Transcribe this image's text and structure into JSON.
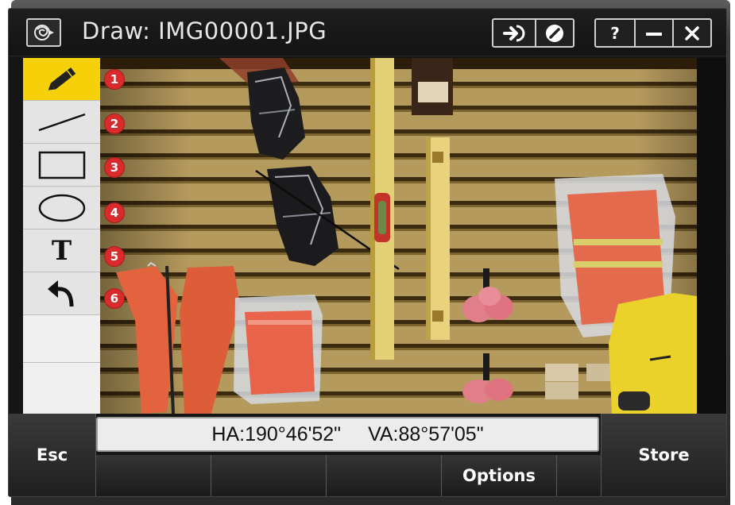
{
  "window": {
    "title": "Draw: IMG00001.JPG"
  },
  "titlebar": {
    "app_icon": "rose-logo-icon",
    "buttons": [
      {
        "name": "enter-arrow-icon"
      },
      {
        "name": "no-entry-icon"
      },
      {
        "label": "?"
      },
      {
        "label": "—"
      },
      {
        "label": "✕"
      }
    ]
  },
  "tools": [
    {
      "number": "1",
      "icon": "pencil-icon",
      "active": true
    },
    {
      "number": "2",
      "icon": "line-icon"
    },
    {
      "number": "3",
      "icon": "rectangle-icon"
    },
    {
      "number": "4",
      "icon": "ellipse-icon"
    },
    {
      "number": "5",
      "icon": "text-icon",
      "glyph": "T"
    },
    {
      "number": "6",
      "icon": "undo-icon"
    }
  ],
  "angles": {
    "ha": "HA:190°46'52\"",
    "va": "VA:88°57'05\""
  },
  "softkeys": {
    "esc": "Esc",
    "store": "Store",
    "options": "Options"
  },
  "colors": {
    "active_tool": "#f6d10a",
    "badge": "#d92b2b",
    "wall": "#b59a5d"
  }
}
